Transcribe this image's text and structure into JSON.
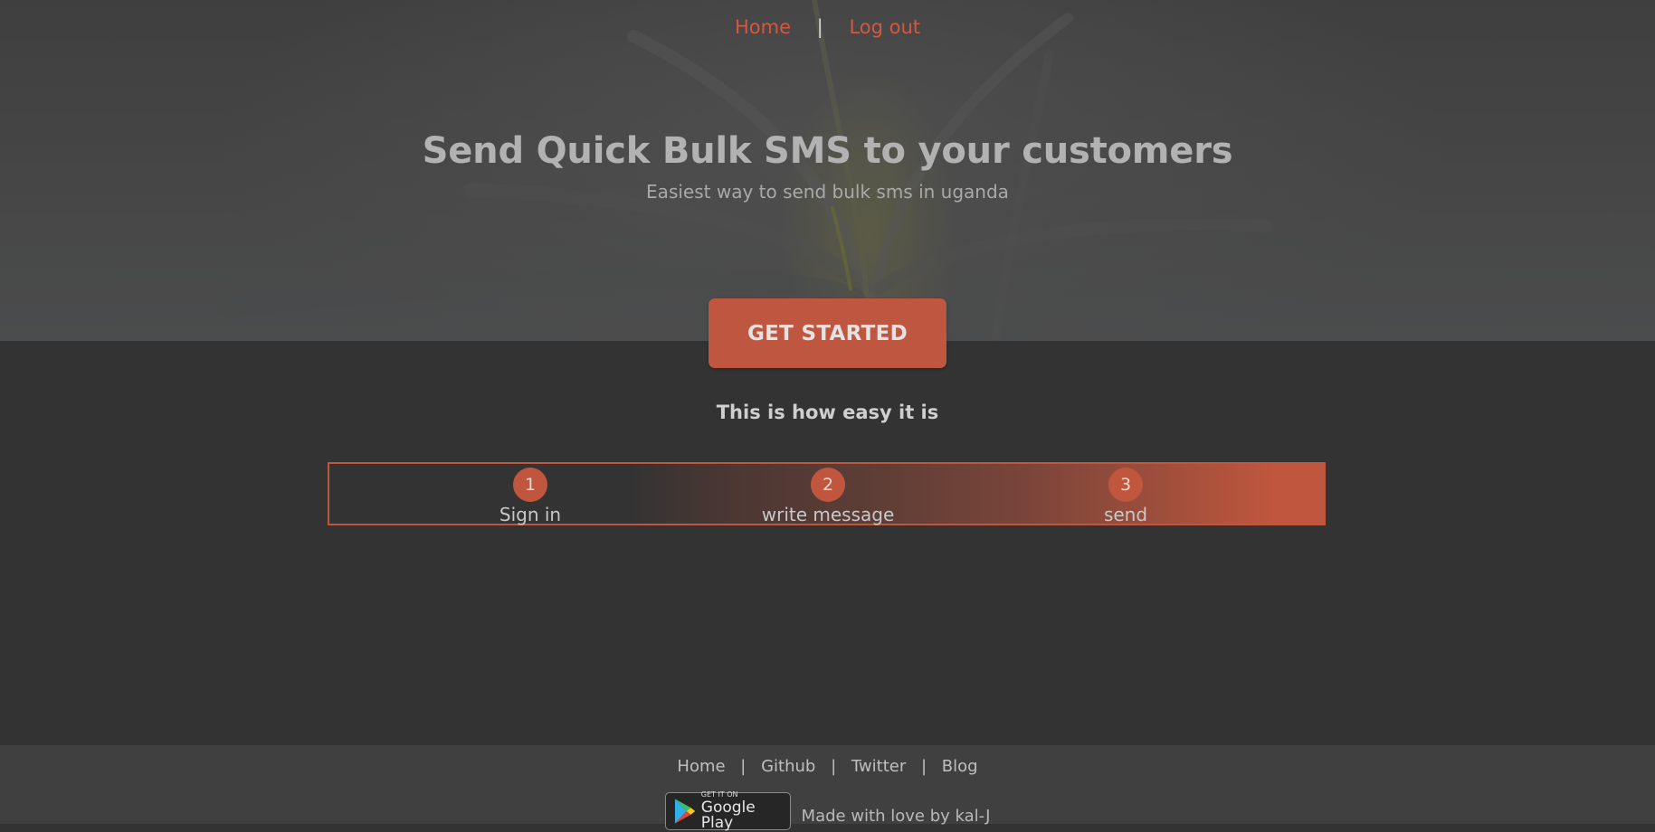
{
  "nav": {
    "home": "Home",
    "separator": "|",
    "logout": "Log out"
  },
  "hero": {
    "title": "Send Quick Bulk SMS to your customers",
    "subtitle": "Easiest way to send bulk sms in uganda",
    "cta_label": "GET STARTED"
  },
  "how": {
    "heading": "This is how easy it is",
    "steps": [
      {
        "number": "1",
        "label": "Sign in"
      },
      {
        "number": "2",
        "label": "write message"
      },
      {
        "number": "3",
        "label": "send"
      }
    ]
  },
  "footer": {
    "links": [
      {
        "label": "Home"
      },
      {
        "label": "Github"
      },
      {
        "label": "Twitter"
      },
      {
        "label": "Blog"
      }
    ],
    "separator": "|",
    "badge": {
      "small_text": "GET IT ON",
      "big_text": "Google Play",
      "icon": "google-play-icon"
    },
    "credit": "Made with love by kal-J"
  },
  "colors": {
    "accent": "#c0563e",
    "background": "#333333",
    "hero_background": "#474747",
    "footer_background": "#404040"
  }
}
